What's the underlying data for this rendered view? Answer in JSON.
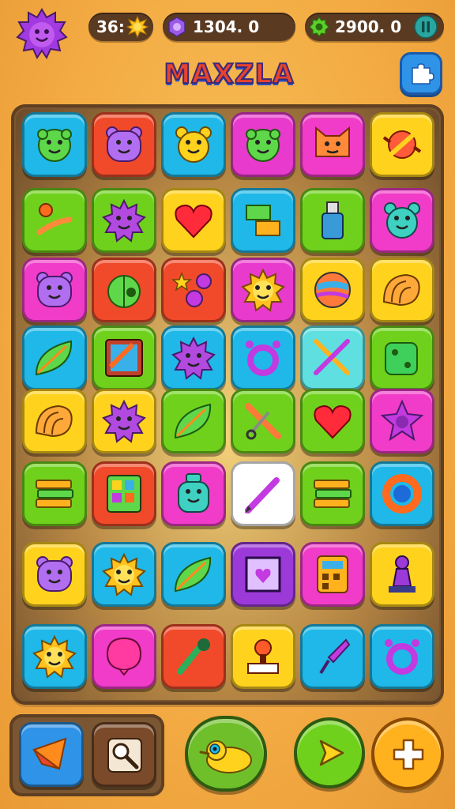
{
  "header": {
    "title": "MAXZLA",
    "currencies": [
      {
        "name": "stars",
        "value": "36:",
        "icon": "sun-icon"
      },
      {
        "name": "gems",
        "value": "1304. 0",
        "icon": "gem-icon"
      },
      {
        "name": "coins",
        "value": "2900. 0",
        "icon": "gear-icon"
      }
    ],
    "pause_icon": "pause-icon",
    "avatar_icon": "sun-avatar-icon",
    "puzzle_icon": "puzzle-icon"
  },
  "board": {
    "rows": 8,
    "cols": 6,
    "tiles": [
      {
        "color": "#1fb8e8",
        "icon": "green-monster-icon"
      },
      {
        "color": "#f04a2a",
        "icon": "purple-bear-icon"
      },
      {
        "color": "#1fb8e8",
        "icon": "yellow-bear-icon"
      },
      {
        "color": "#e83acc",
        "icon": "green-monster-icon"
      },
      {
        "color": "#f03cc8",
        "icon": "orange-cat-icon"
      },
      {
        "color": "#ffd21e",
        "icon": "red-candy-icon"
      },
      {
        "color": "#6fd11c",
        "icon": "bubbles-icon"
      },
      {
        "color": "#6fd11c",
        "icon": "purple-sun-icon"
      },
      {
        "color": "#ffd21e",
        "icon": "heart-icon"
      },
      {
        "color": "#1fb8e8",
        "icon": "blocks-icon"
      },
      {
        "color": "#6fd11c",
        "icon": "bottle-icon"
      },
      {
        "color": "#f03cc8",
        "icon": "teal-bear-icon"
      },
      {
        "color": "#f03cc8",
        "icon": "purple-bear-icon"
      },
      {
        "color": "#f04a2a",
        "icon": "green-fruit-icon"
      },
      {
        "color": "#f04a2a",
        "icon": "star-bubbles-icon"
      },
      {
        "color": "#e83acc",
        "icon": "sun-icon"
      },
      {
        "color": "#ffd21e",
        "icon": "ball-icon"
      },
      {
        "color": "#ffd21e",
        "icon": "shell-icon"
      },
      {
        "color": "#1fb8e8",
        "icon": "leaf-icon"
      },
      {
        "color": "#6fd11c",
        "icon": "frame-icon"
      },
      {
        "color": "#1fb8e8",
        "icon": "purple-sun-icon"
      },
      {
        "color": "#1fb8e8",
        "icon": "ring-icon"
      },
      {
        "color": "#5fdfe0",
        "icon": "pencils-icon"
      },
      {
        "color": "#6fd11c",
        "icon": "dice-icon"
      },
      {
        "color": "#ffd21e",
        "icon": "shell-icon"
      },
      {
        "color": "#ffd21e",
        "icon": "purple-sun-icon"
      },
      {
        "color": "#6fd11c",
        "icon": "leaf-icon"
      },
      {
        "color": "#6fd11c",
        "icon": "tools-icon"
      },
      {
        "color": "#6fd11c",
        "icon": "heart-icon"
      },
      {
        "color": "#f03cc8",
        "icon": "purple-star-icon"
      },
      {
        "color": "#6fd11c",
        "icon": "book-stack-icon"
      },
      {
        "color": "#f04a2a",
        "icon": "board-icon"
      },
      {
        "color": "#f03cc8",
        "icon": "teal-robot-icon"
      },
      {
        "color": "#ffffff",
        "icon": "pen-icon"
      },
      {
        "color": "#6fd11c",
        "icon": "book-stack-icon"
      },
      {
        "color": "#1fb8e8",
        "icon": "donut-icon"
      },
      {
        "color": "#ffd21e",
        "icon": "purple-bear-icon"
      },
      {
        "color": "#1fb8e8",
        "icon": "sun-icon"
      },
      {
        "color": "#1fb8e8",
        "icon": "leaf-icon"
      },
      {
        "color": "#9b3ad8",
        "icon": "picture-icon"
      },
      {
        "color": "#f03cc8",
        "icon": "calculator-icon"
      },
      {
        "color": "#ffd21e",
        "icon": "pawn-icon"
      },
      {
        "color": "#1fb8e8",
        "icon": "sun-icon"
      },
      {
        "color": "#f03cc8",
        "icon": "balloon-icon"
      },
      {
        "color": "#f04a2a",
        "icon": "brush-icon"
      },
      {
        "color": "#ffd21e",
        "icon": "stamp-icon"
      },
      {
        "color": "#1fb8e8",
        "icon": "rocket-icon"
      },
      {
        "color": "#1fb8e8",
        "icon": "ring-icon"
      }
    ]
  },
  "footer": {
    "tray_buttons": [
      {
        "color": "#2f93e8",
        "icon": "cheese-icon"
      },
      {
        "color": "#7a4a2a",
        "icon": "magnifier-icon"
      }
    ],
    "center_button": {
      "color": "#6fbf2a",
      "icon": "creature-icon"
    },
    "play_button": {
      "color": "#6fd11c",
      "icon": "arrow-right-icon"
    },
    "add_button": {
      "color": "#ffb21e",
      "icon": "plus-icon"
    }
  }
}
